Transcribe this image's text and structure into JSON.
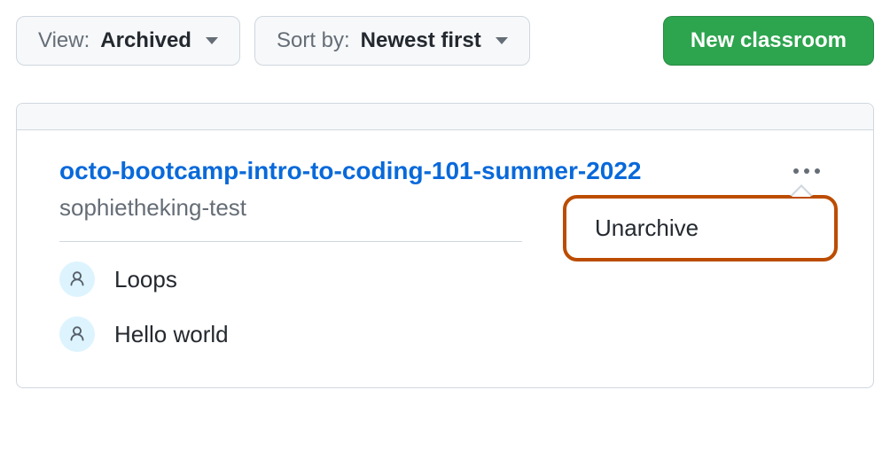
{
  "toolbar": {
    "view": {
      "prefix": "View:",
      "value": "Archived"
    },
    "sort": {
      "prefix": "Sort by:",
      "value": "Newest first"
    },
    "new_button": "New classroom"
  },
  "classroom": {
    "title": "octo-bootcamp-intro-to-coding-101-summer-2022",
    "org": "sophietheking-test",
    "assignments": [
      {
        "label": "Loops"
      },
      {
        "label": "Hello world"
      }
    ]
  },
  "menu": {
    "unarchive": "Unarchive"
  }
}
